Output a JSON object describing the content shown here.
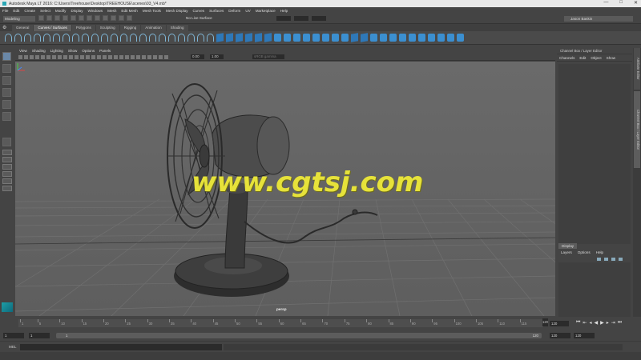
{
  "window": {
    "title": "Autodesk Maya LT 2016: C:\\Users\\Treehouse\\Desktop\\TREEHOUSE\\scenes\\03_V4.mb*",
    "controls": [
      "—",
      "□",
      "✕"
    ]
  },
  "menu": [
    "File",
    "Edit",
    "Create",
    "Select",
    "Modify",
    "Display",
    "Windows",
    "Mesh",
    "Edit Mesh",
    "Mesh Tools",
    "Mesh Display",
    "Curves",
    "Surfaces",
    "Deform",
    "UV",
    "Marketplace",
    "Help"
  ],
  "status": {
    "mode": "Modeling",
    "live_surface": "No Live Surface",
    "user": "Jason Baskin"
  },
  "shelf_tabs": [
    {
      "label": "General",
      "active": false
    },
    {
      "label": "Curves / Surfaces",
      "active": true
    },
    {
      "label": "Polygons",
      "active": false
    },
    {
      "label": "Sculpting",
      "active": false
    },
    {
      "label": "Rigging",
      "active": false
    },
    {
      "label": "Animation",
      "active": false
    },
    {
      "label": "Shading",
      "active": false
    }
  ],
  "panel_menu": [
    "View",
    "Shading",
    "Lighting",
    "Show",
    "Options",
    "Panels"
  ],
  "panel_toolbar": {
    "exposure": "0.00",
    "gamma": "1.00",
    "color_space": "sRGB gamma"
  },
  "viewport": {
    "camera": "persp",
    "watermark": "www.cgtsj.com",
    "watermark_color": "#e6e23a"
  },
  "side_tabs": [
    "Attribute Editor",
    "Channel Box / Layer Editor"
  ],
  "channel_box": {
    "header": "Channel Box / Layer Editor",
    "menu": [
      "Channels",
      "Edit",
      "Object",
      "Show"
    ],
    "display_tab": "Display",
    "layer_menu": [
      "Layers",
      "Options",
      "Help"
    ]
  },
  "time_slider": {
    "ticks": [
      "1",
      "5",
      "10",
      "15",
      "20",
      "25",
      "30",
      "35",
      "40",
      "45",
      "50",
      "55",
      "60",
      "65",
      "70",
      "75",
      "80",
      "85",
      "90",
      "95",
      "100",
      "105",
      "110",
      "115"
    ],
    "end_marker": "120",
    "current_frame": "120"
  },
  "range_slider": {
    "start": "1",
    "anim_start": "1",
    "range_start_label": "1",
    "range_end_label": "120",
    "anim_end": "120",
    "end": "120"
  },
  "mel": {
    "label": "MEL"
  }
}
